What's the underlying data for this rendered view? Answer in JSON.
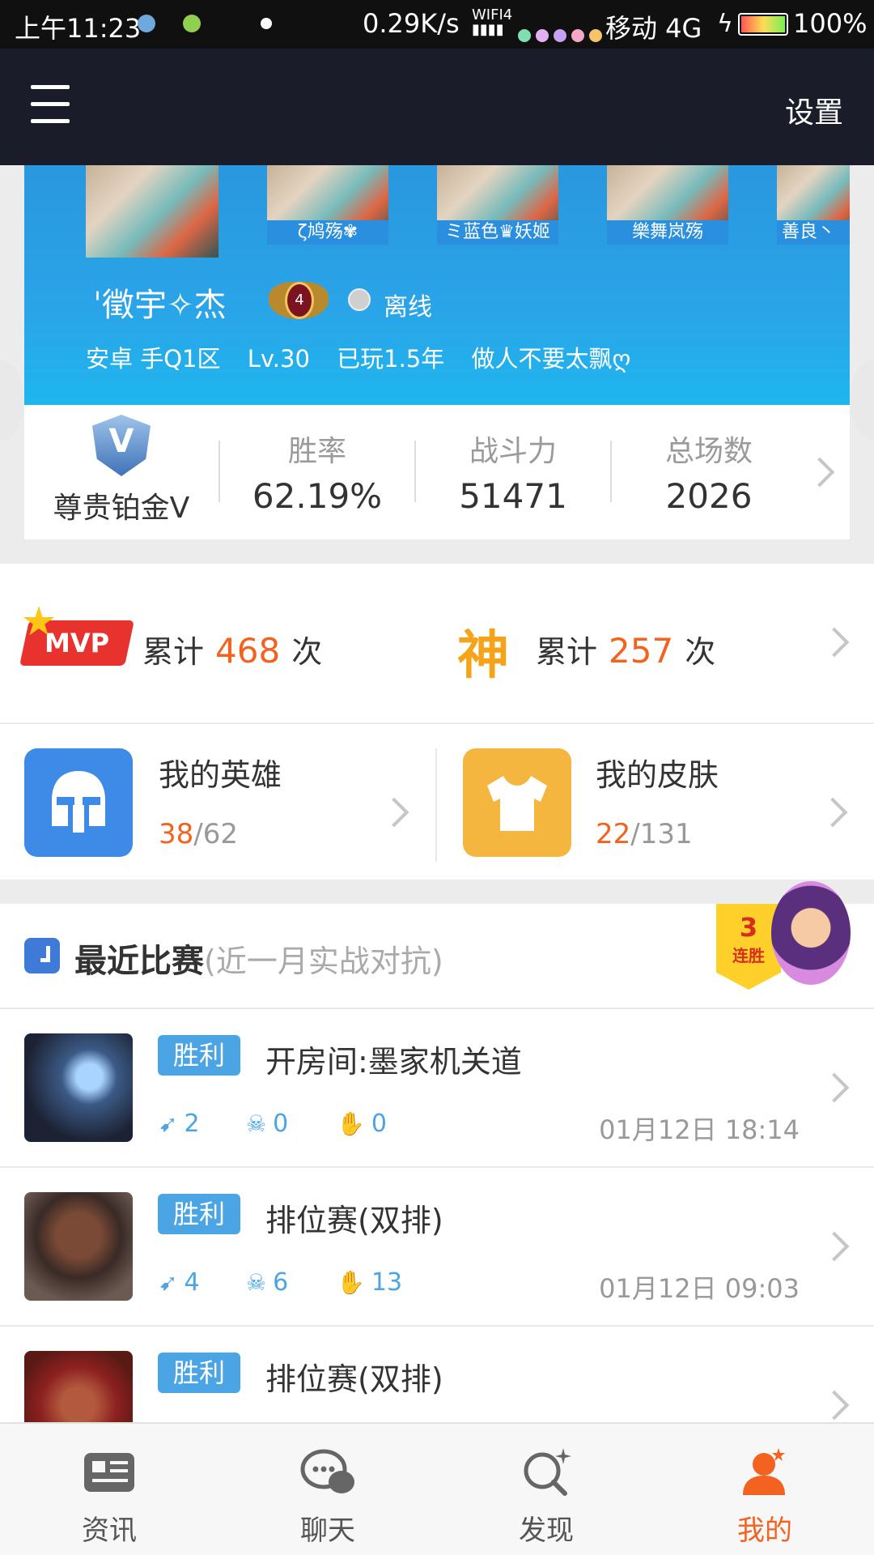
{
  "status_bar": {
    "time": "上午11:23",
    "net_speed": "0.29K/s",
    "wifi_label": "WIFI4",
    "carrier": "移动 4G",
    "battery": "100%"
  },
  "header": {
    "settings_label": "设置"
  },
  "profile": {
    "friends": [
      {
        "name": ""
      },
      {
        "name": "ζ鸠殇✾"
      },
      {
        "name": "ミ蓝色♛妖姬"
      },
      {
        "name": "樂舞岚殇"
      },
      {
        "name": "善良丶"
      }
    ],
    "name": "ˈ徵宇✧杰",
    "rank_level": "4",
    "status": "离线",
    "server": "安卓 手Q1区",
    "level": "Lv.30",
    "played": "已玩1.5年",
    "signature": "做人不要太飘ღ"
  },
  "stats": {
    "tier": "尊贵铂金V",
    "tier_letter": "V",
    "items": [
      {
        "label": "胜率",
        "value": "62.19%"
      },
      {
        "label": "战斗力",
        "value": "51471"
      },
      {
        "label": "总场数",
        "value": "2026"
      }
    ]
  },
  "achievements": {
    "mvp_badge": "MVP",
    "mvp_prefix": "累计",
    "mvp_count": "468",
    "mvp_suffix": "次",
    "god_badge": "神",
    "god_prefix": "累计",
    "god_count": "257",
    "god_suffix": "次"
  },
  "collection": {
    "heroes": {
      "title": "我的英雄",
      "owned": "38",
      "total": "62"
    },
    "skins": {
      "title": "我的皮肤",
      "owned": "22",
      "total": "131"
    }
  },
  "recent": {
    "title": "最近比赛",
    "subtitle": "(近一月实战对抗)",
    "streak_count": "3",
    "streak_label": "连胜",
    "matches": [
      {
        "result": "胜利",
        "mode": "开房间:墨家机关道",
        "kills": "2",
        "deaths": "0",
        "assists": "0",
        "time": "01月12日 18:14"
      },
      {
        "result": "胜利",
        "mode": "排位赛(双排)",
        "kills": "4",
        "deaths": "6",
        "assists": "13",
        "time": "01月12日 09:03"
      },
      {
        "result": "胜利",
        "mode": "排位赛(双排)",
        "kills": "",
        "deaths": "",
        "assists": "",
        "time": ""
      }
    ]
  },
  "nav": {
    "items": [
      {
        "label": "资讯"
      },
      {
        "label": "聊天"
      },
      {
        "label": "发现"
      },
      {
        "label": "我的"
      }
    ]
  },
  "colors": {
    "accent": "#f4621f",
    "primary_blue": "#2aa4e8",
    "header_dark": "#1b1c2a",
    "result_blue": "#4ba5e5"
  }
}
